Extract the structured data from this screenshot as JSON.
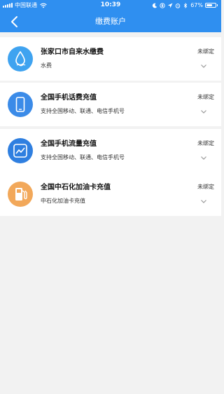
{
  "status_bar": {
    "carrier": "中国联通",
    "time": "10:39",
    "battery_percent": "67%",
    "battery_level": 0.67
  },
  "header": {
    "title": "缴费账户",
    "background_color": "#2f8ff0"
  },
  "accounts": [
    {
      "title": "张家口市自来水缴费",
      "description": "水费",
      "status": "未绑定",
      "icon": "water-drop-icon",
      "icon_color": "#3fa3f0"
    },
    {
      "title": "全国手机话费充值",
      "description": "支持全国移动、联通、电信手机号",
      "status": "未绑定",
      "icon": "mobile-phone-icon",
      "icon_color": "#3b8be8"
    },
    {
      "title": "全国手机流量充值",
      "description": "支持全国移动、联通、电信手机号",
      "status": "未绑定",
      "icon": "data-trend-icon",
      "icon_color": "#2f7fe0"
    },
    {
      "title": "全国中石化加油卡充值",
      "description": "中石化加油卡充值",
      "status": "未绑定",
      "icon": "gas-pump-icon",
      "icon_color": "#f2a85a"
    }
  ]
}
